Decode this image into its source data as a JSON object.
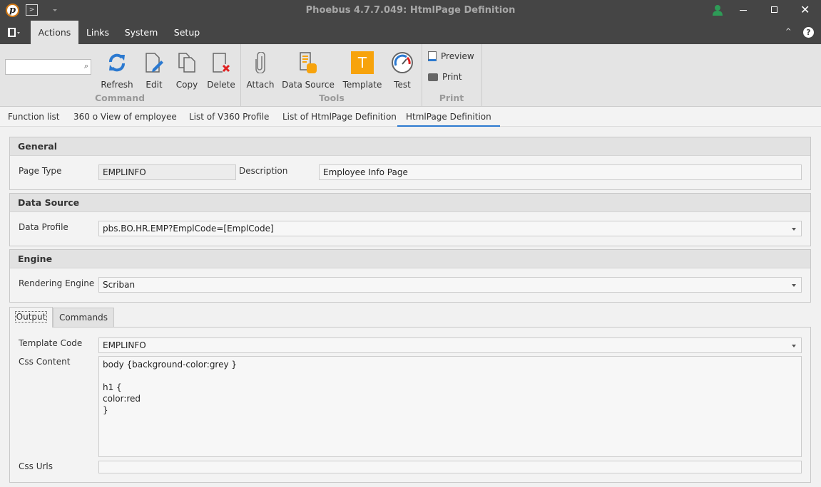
{
  "window": {
    "title": "Phoebus 4.7.7.049: HtmlPage Definition"
  },
  "menu": {
    "tabs": [
      "Actions",
      "Links",
      "System",
      "Setup"
    ]
  },
  "ribbon": {
    "search": {
      "value": "",
      "placeholder": ""
    },
    "groups": {
      "command": "Command",
      "tools": "Tools",
      "print": "Print"
    },
    "buttons": {
      "refresh": "Refresh",
      "edit": "Edit",
      "copy": "Copy",
      "delete": "Delete",
      "attach": "Attach",
      "data_source": "Data Source",
      "template": "Template",
      "template_glyph": "T",
      "test": "Test",
      "preview": "Preview",
      "print": "Print"
    }
  },
  "doc_tabs": [
    "Function list",
    "360 o View of employee",
    "List of V360 Profile",
    "List of HtmlPage Definition",
    "HtmlPage Definition"
  ],
  "general": {
    "title": "General",
    "page_type_label": "Page Type",
    "page_type": "EMPLINFO",
    "description_label": "Description",
    "description": "Employee Info Page"
  },
  "data_source": {
    "title": "Data Source",
    "data_profile_label": "Data Profile",
    "data_profile": "pbs.BO.HR.EMP?EmplCode=[EmplCode]"
  },
  "engine": {
    "title": "Engine",
    "rendering_engine_label": "Rendering Engine",
    "rendering_engine": "Scriban"
  },
  "inner_tabs": [
    "Output",
    "Commands"
  ],
  "output": {
    "template_code_label": "Template Code",
    "template_code": "EMPLINFO",
    "css_content_label": "Css Content",
    "css_content": "body {background-color:grey }\n\nh1 {\ncolor:red\n}",
    "css_urls_label": "Css Urls",
    "css_urls": ""
  },
  "colors": {
    "accent": "#2b79d0",
    "template_orange": "#f7a30c",
    "user_green": "#2e9b57"
  }
}
